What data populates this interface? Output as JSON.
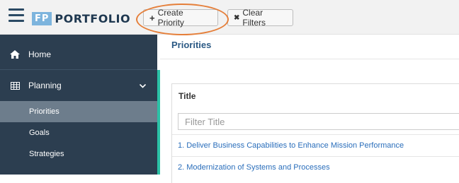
{
  "header": {
    "logo_badge": "FP",
    "logo_text": "PORTFOLIO",
    "create_label": "Create Priority",
    "create_icon": "+",
    "clear_label": "Clear Filters",
    "clear_icon": "✖",
    "highlight_color": "#e57f3a"
  },
  "sidebar": {
    "home": {
      "label": "Home",
      "icon": "home-icon"
    },
    "planning": {
      "label": "Planning",
      "icon": "table-icon",
      "expanded": true
    },
    "sub_items": [
      {
        "label": "Priorities",
        "active": true
      },
      {
        "label": "Goals",
        "active": false
      },
      {
        "label": "Strategies",
        "active": false
      }
    ],
    "accent_color": "#2bc1a6",
    "bg_color": "#2c3e50"
  },
  "main": {
    "title": "Priorities",
    "table": {
      "column_title": "Title",
      "filter_placeholder": "Filter Title",
      "rows": [
        "1. Deliver Business Capabilities to Enhance Mission Performance",
        "2. Modernization of Systems and Processes"
      ]
    }
  }
}
